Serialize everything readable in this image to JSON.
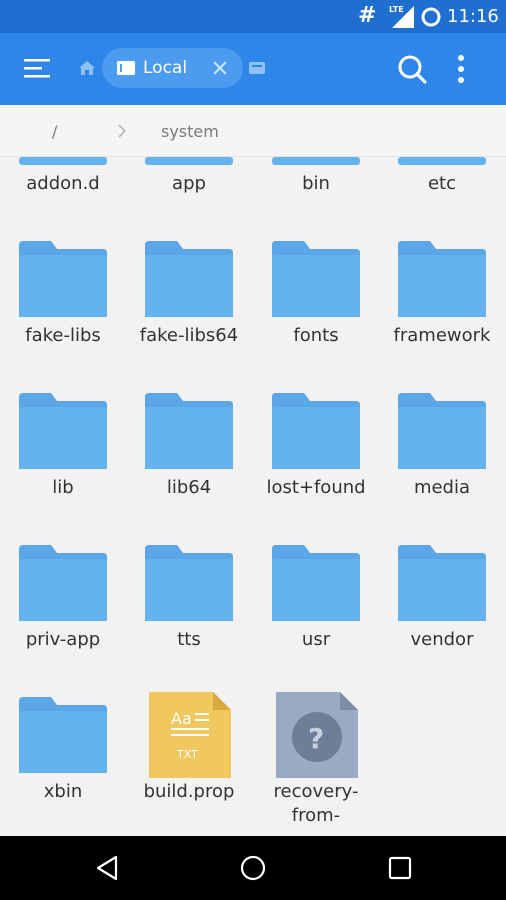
{
  "status_bar": {
    "hash": "#",
    "network": "LTE",
    "time": "11:16"
  },
  "toolbar": {
    "tab_label": "Local"
  },
  "breadcrumb": {
    "root": "/",
    "current": "system"
  },
  "grid": {
    "partial_row": [
      "addon.d",
      "app",
      "bin",
      "etc"
    ],
    "rows": [
      [
        {
          "label": "fake-libs",
          "type": "folder"
        },
        {
          "label": "fake-libs64",
          "type": "folder"
        },
        {
          "label": "fonts",
          "type": "folder"
        },
        {
          "label": "framework",
          "type": "folder"
        }
      ],
      [
        {
          "label": "lib",
          "type": "folder"
        },
        {
          "label": "lib64",
          "type": "folder"
        },
        {
          "label": "lost+found",
          "type": "folder"
        },
        {
          "label": "media",
          "type": "folder"
        }
      ],
      [
        {
          "label": "priv-app",
          "type": "folder"
        },
        {
          "label": "tts",
          "type": "folder"
        },
        {
          "label": "usr",
          "type": "folder"
        },
        {
          "label": "vendor",
          "type": "folder"
        }
      ],
      [
        {
          "label": "xbin",
          "type": "folder"
        },
        {
          "label": "build.prop",
          "type": "txt"
        },
        {
          "label": "recovery-from-",
          "type": "unknown"
        }
      ]
    ],
    "txt_badge_top": "Aa",
    "txt_badge_bottom": "TXT",
    "unknown_glyph": "?"
  },
  "colors": {
    "status_bar": "#1f6fd0",
    "toolbar": "#2e86e8",
    "folder": "#64b2ee",
    "folder_tab": "#5aa6e6",
    "txt_file": "#f1c760",
    "unknown_file": "#9aaac4"
  }
}
